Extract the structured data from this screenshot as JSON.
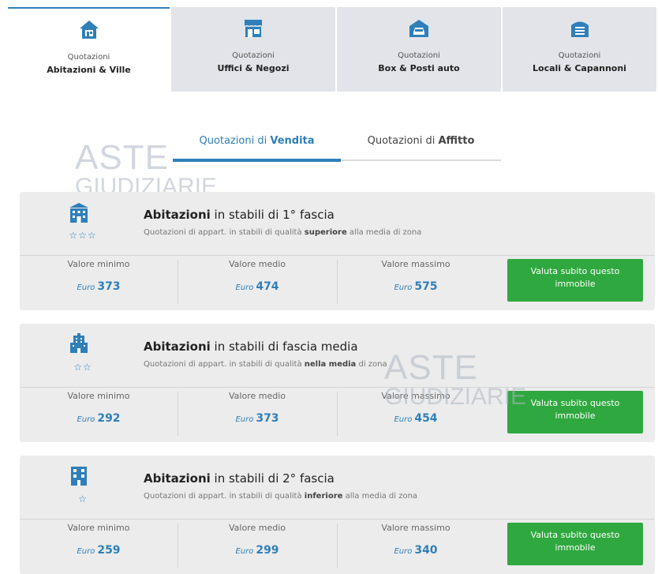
{
  "property_tabs": [
    {
      "title": "Quotazioni",
      "subtitle": "Abitazioni & Ville",
      "icon": "house-icon",
      "active": true
    },
    {
      "title": "Quotazioni",
      "subtitle": "Uffici & Negozi",
      "icon": "shop-icon",
      "active": false
    },
    {
      "title": "Quotazioni",
      "subtitle": "Box & Posti auto",
      "icon": "garage-car-icon",
      "active": false
    },
    {
      "title": "Quotazioni",
      "subtitle": "Locali & Capannoni",
      "icon": "warehouse-icon",
      "active": false
    }
  ],
  "mode_tabs": [
    {
      "prefix": "Quotazioni di ",
      "bold": "Vendita",
      "active": true
    },
    {
      "prefix": "Quotazioni di ",
      "bold": "Affitto",
      "active": false
    }
  ],
  "watermark": {
    "line1": "ASTE",
    "line2": "GIUDIZIARIE"
  },
  "categories": [
    {
      "icon": "luxury-building-icon",
      "stars": "☆☆☆",
      "title_bold": "Abitazioni",
      "title_rest": " in stabili di 1° fascia",
      "desc_prefix": "Quotazioni di appart. in stabili di qualità ",
      "desc_bold": "superiore",
      "desc_suffix": " alla media di zona",
      "min_label": "Valore minimo",
      "min_currency": "Euro",
      "min_value": "373",
      "avg_label": "Valore medio",
      "avg_currency": "Euro",
      "avg_value": "474",
      "max_label": "Valore massimo",
      "max_currency": "Euro",
      "max_value": "575",
      "cta": "Valuta subito questo immobile"
    },
    {
      "icon": "office-building-icon",
      "stars": "☆☆",
      "title_bold": "Abitazioni",
      "title_rest": " in stabili di fascia media",
      "desc_prefix": "Quotazioni di appart. in stabili di qualità ",
      "desc_bold": "nella media",
      "desc_suffix": " di zona",
      "min_label": "Valore minimo",
      "min_currency": "Euro",
      "min_value": "292",
      "avg_label": "Valore medio",
      "avg_currency": "Euro",
      "avg_value": "373",
      "max_label": "Valore massimo",
      "max_currency": "Euro",
      "max_value": "454",
      "cta": "Valuta subito questo immobile"
    },
    {
      "icon": "apartment-block-icon",
      "stars": "☆",
      "title_bold": "Abitazioni",
      "title_rest": " in stabili di 2° fascia",
      "desc_prefix": "Quotazioni di appart. in stabili di qualità ",
      "desc_bold": "inferiore",
      "desc_suffix": " alla media di zona",
      "min_label": "Valore minimo",
      "min_currency": "Euro",
      "min_value": "259",
      "avg_label": "Valore medio",
      "avg_currency": "Euro",
      "avg_value": "299",
      "max_label": "Valore massimo",
      "max_currency": "Euro",
      "max_value": "340",
      "cta": "Valuta subito questo immobile"
    }
  ],
  "colors": {
    "accent": "#2f7fb9",
    "cta": "#2fa83f",
    "tab_inactive": "#e2e4e9",
    "card_bg": "#ececec"
  }
}
